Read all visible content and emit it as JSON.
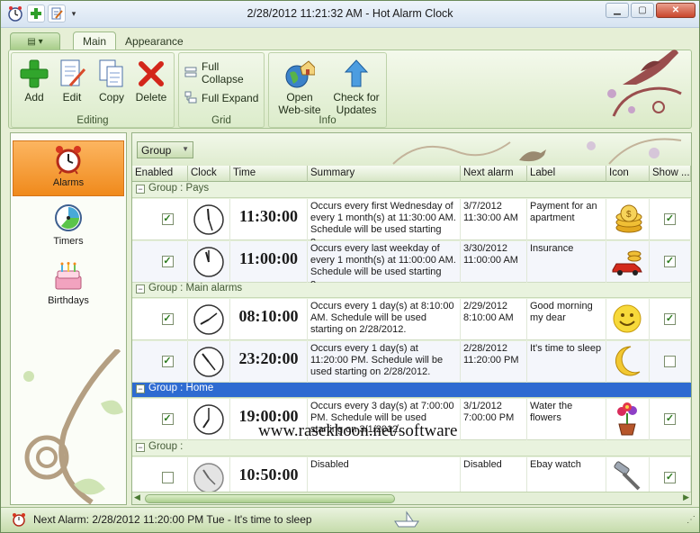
{
  "window": {
    "title": "2/28/2012 11:21:32 AM - Hot Alarm Clock",
    "controls": [
      "minimize",
      "maximize",
      "close"
    ]
  },
  "ribbon": {
    "tabs": [
      {
        "label": "Main",
        "active": true
      },
      {
        "label": "Appearance",
        "active": false
      }
    ],
    "groups": {
      "editing": {
        "label": "Editing",
        "buttons": [
          {
            "label": "Add",
            "icon": "plus-icon"
          },
          {
            "label": "Edit",
            "icon": "edit-doc-icon"
          },
          {
            "label": "Copy",
            "icon": "copy-icon"
          },
          {
            "label": "Delete",
            "icon": "delete-x-icon"
          }
        ]
      },
      "grid": {
        "label": "Grid",
        "buttons": [
          {
            "label": "Full Collapse",
            "icon": "collapse-icon"
          },
          {
            "label": "Full Expand",
            "icon": "expand-icon"
          }
        ]
      },
      "info": {
        "label": "Info",
        "buttons": [
          {
            "label": "Open Web-site",
            "line1": "Open",
            "line2": "Web-site",
            "icon": "globe-house-icon"
          },
          {
            "label": "Check for Updates",
            "line1": "Check for",
            "line2": "Updates",
            "icon": "up-arrow-icon"
          }
        ]
      }
    }
  },
  "nav": {
    "items": [
      {
        "label": "Alarms",
        "icon": "alarm-clock-icon",
        "active": true
      },
      {
        "label": "Timers",
        "icon": "timer-icon",
        "active": false
      },
      {
        "label": "Birthdays",
        "icon": "birthday-cake-icon",
        "active": false
      }
    ]
  },
  "groupby": {
    "label": "Group"
  },
  "grid": {
    "columns": [
      "Enabled",
      "Clock",
      "Time",
      "Summary",
      "Next alarm",
      "Label",
      "Icon",
      "Show ..."
    ],
    "groups": [
      {
        "header": "Group : Pays",
        "selected": false,
        "rows": [
          {
            "enabled": true,
            "clock": "11:30",
            "time": "11:30:00",
            "summary": "Occurs every first Wednesday of every 1 month(s) at 11:30:00 AM. Schedule will be used starting o...",
            "next": "3/7/2012 11:30:00 AM",
            "label": "Payment for an apartment",
            "icon": "coins-icon",
            "show": true
          },
          {
            "enabled": true,
            "clock": "11:00",
            "time": "11:00:00",
            "summary": "Occurs every last weekday of every 1 month(s) at 11:00:00 AM. Schedule will be used starting o...",
            "next": "3/30/2012 11:00:00 AM",
            "label": "Insurance",
            "icon": "car-coins-icon",
            "show": true
          }
        ]
      },
      {
        "header": "Group : Main alarms",
        "selected": false,
        "rows": [
          {
            "enabled": true,
            "clock": "08:10",
            "time": "08:10:00",
            "summary": "Occurs every 1 day(s) at 8:10:00 AM. Schedule will be used starting on 2/28/2012.",
            "next": "2/29/2012 8:10:00 AM",
            "label": "Good morning my dear",
            "icon": "sun-smile-icon",
            "show": true
          },
          {
            "enabled": true,
            "clock": "23:20",
            "time": "23:20:00",
            "summary": "Occurs every 1 day(s) at 11:20:00 PM. Schedule will be used starting on 2/28/2012.",
            "next": "2/28/2012 11:20:00 PM",
            "label": "It's time to sleep",
            "icon": "moon-icon",
            "show": false
          }
        ]
      },
      {
        "header": "Group : Home",
        "selected": true,
        "rows": [
          {
            "enabled": true,
            "clock": "19:00",
            "time": "19:00:00",
            "summary": "Occurs every 3 day(s) at 7:00:00 PM. Schedule will be used starting on 3/1/2012.",
            "next": "3/1/2012 7:00:00 PM",
            "label": "Water the flowers",
            "icon": "flower-pot-icon",
            "show": true
          }
        ]
      },
      {
        "header": "Group :",
        "selected": false,
        "rows": [
          {
            "enabled": false,
            "clock": "10:50",
            "time": "10:50:00",
            "summary": "Disabled",
            "next": "Disabled",
            "label": "Ebay watch",
            "icon": "gavel-icon",
            "show": true
          }
        ]
      }
    ]
  },
  "watermark": "www.rasekhoon.net/software",
  "status": {
    "text": "Next Alarm: 2/28/2012 11:20:00 PM Tue - It's time to sleep"
  }
}
